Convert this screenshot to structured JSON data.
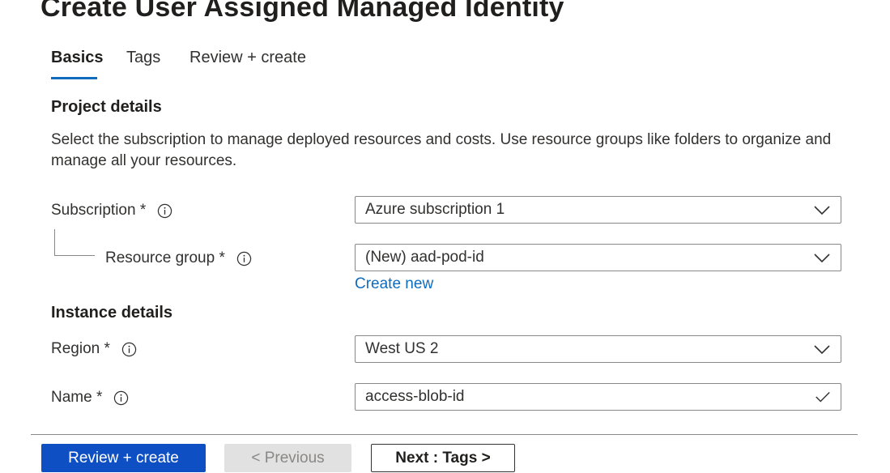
{
  "page": {
    "title": "Create User Assigned Managed Identity"
  },
  "tabs": [
    {
      "label": "Basics",
      "active": true
    },
    {
      "label": "Tags",
      "active": false
    },
    {
      "label": "Review + create",
      "active": false
    }
  ],
  "project": {
    "heading": "Project details",
    "description": "Select the subscription to manage deployed resources and costs. Use resource groups like folders to organize and manage all your resources.",
    "subscription": {
      "label": "Subscription *",
      "value": "Azure subscription 1",
      "info_icon": "info-icon",
      "chevron_icon": "chevron-down-icon"
    },
    "resource_group": {
      "label": "Resource group *",
      "value": "(New) aad-pod-id",
      "create_new": "Create new",
      "info_icon": "info-icon",
      "chevron_icon": "chevron-down-icon"
    }
  },
  "instance": {
    "heading": "Instance details",
    "region": {
      "label": "Region *",
      "value": "West US 2",
      "info_icon": "info-icon",
      "chevron_icon": "chevron-down-icon"
    },
    "name": {
      "label": "Name *",
      "value": "access-blob-id",
      "info_icon": "info-icon",
      "status_icon": "checkmark-icon"
    }
  },
  "footer": {
    "review_create": "Review + create",
    "previous": "< Previous",
    "next": "Next : Tags >"
  },
  "colors": {
    "accent": "#0f6cbd",
    "primary_button": "#0f4fc4",
    "disabled_button": "#e1e1e1",
    "border": "#8a8886"
  }
}
